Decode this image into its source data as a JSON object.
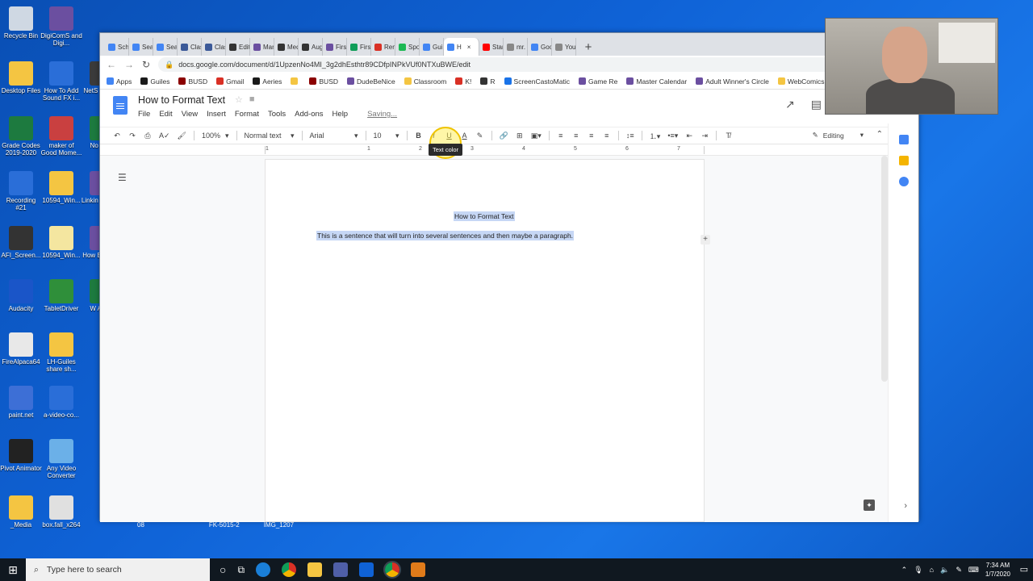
{
  "desktop": {
    "icons": [
      {
        "label": "Recycle Bin",
        "color": "#cfd8e3"
      },
      {
        "label": "DigiComS and Digi...",
        "color": "#6b4fa0"
      },
      {
        "label": "Desktop Files",
        "color": "#f4c542"
      },
      {
        "label": "How To Add Sound FX i...",
        "color": "#2a6ed8"
      },
      {
        "label": "NetS Scho...",
        "color": "#3a3a3a"
      },
      {
        "label": "Grade Codes 2019-2020",
        "color": "#1d7a3f"
      },
      {
        "label": "maker of Good Mome...",
        "color": "#c94040"
      },
      {
        "label": "No Ph...",
        "color": "#1d7a3f"
      },
      {
        "label": "Recording #21",
        "color": "#2a6ed8"
      },
      {
        "label": "10594_Win...",
        "color": "#f4c542"
      },
      {
        "label": "Linkin to Pla...",
        "color": "#6b4fa0"
      },
      {
        "label": "AFI_Screen...",
        "color": "#333333"
      },
      {
        "label": "10594_Win...",
        "color": "#f4e6a0"
      },
      {
        "label": "How Bad G...",
        "color": "#6b4fa0"
      },
      {
        "label": "Audacity",
        "color": "#1a55c8"
      },
      {
        "label": "TabletDriver",
        "color": "#2f8f3a"
      },
      {
        "label": "W Ass...",
        "color": "#1d7a3f"
      },
      {
        "label": "FireAlpaca64",
        "color": "#e8e8e8"
      },
      {
        "label": "LH-Guiles share sh...",
        "color": "#f4c542"
      },
      {
        "label": "paint.net",
        "color": "#3d6fd6"
      },
      {
        "label": "a-video-co...",
        "color": "#2a6ed8"
      },
      {
        "label": "Pivot Animator",
        "color": "#222222"
      },
      {
        "label": "Any Video Converter",
        "color": "#6bb0e8"
      },
      {
        "label": "_Media",
        "color": "#f4c542"
      },
      {
        "label": "box.fall_x264",
        "color": "#e0e0e0"
      }
    ],
    "lower_labels": [
      "08",
      "FK-5015-2",
      "IMG_1207"
    ]
  },
  "browser": {
    "tabs": [
      {
        "label": "Scho",
        "color": "#4285f4"
      },
      {
        "label": "Seat",
        "color": "#4285f4"
      },
      {
        "label": "Seat",
        "color": "#4285f4"
      },
      {
        "label": "Clas",
        "color": "#3b5998"
      },
      {
        "label": "Clas",
        "color": "#3b5998"
      },
      {
        "label": "Edit",
        "color": "#333333"
      },
      {
        "label": "Man",
        "color": "#6b4fa0"
      },
      {
        "label": "Med",
        "color": "#333333"
      },
      {
        "label": "Augu",
        "color": "#333333"
      },
      {
        "label": "First",
        "color": "#6b4fa0"
      },
      {
        "label": "First",
        "color": "#0f9d58"
      },
      {
        "label": "Rem",
        "color": "#d93025"
      },
      {
        "label": "Spot",
        "color": "#1db954"
      },
      {
        "label": "Guile",
        "color": "#4285f4"
      },
      {
        "label": "H",
        "color": "#4285f4",
        "active": true
      },
      {
        "label": "Star",
        "color": "#ff0000"
      },
      {
        "label": "mr. g",
        "color": "#888888"
      },
      {
        "label": "Goo",
        "color": "#4285f4"
      },
      {
        "label": "Your",
        "color": "#888888"
      }
    ],
    "close_glyph": "×",
    "new_tab": "+",
    "url": "docs.google.com/document/d/1UpzenNo4MI_3g2dhEsthtr89CDfpINPkVUf0NTXuBWE/edit",
    "bookmarks": [
      {
        "label": "Apps",
        "color": "#4285f4"
      },
      {
        "label": "Guiles",
        "color": "#1a1a1a"
      },
      {
        "label": "BUSD",
        "color": "#8b0000"
      },
      {
        "label": "Gmail",
        "color": "#d93025"
      },
      {
        "label": "Aeries",
        "color": "#1a1a1a"
      },
      {
        "label": "",
        "color": "#f4c542"
      },
      {
        "label": "BUSD",
        "color": "#8b0000"
      },
      {
        "label": "DudeBeNice",
        "color": "#6b4fa0"
      },
      {
        "label": "Classroom",
        "color": "#f4c542"
      },
      {
        "label": "K!",
        "color": "#d93025"
      },
      {
        "label": "R",
        "color": "#333333"
      },
      {
        "label": "ScreenCastoMatic",
        "color": "#1a73e8"
      },
      {
        "label": "Game Re",
        "color": "#6b4fa0"
      },
      {
        "label": "Master Calendar",
        "color": "#6b4fa0"
      },
      {
        "label": "Adult Winner's Circle",
        "color": "#6b4fa0"
      },
      {
        "label": "WebComics",
        "color": "#f4c542"
      }
    ]
  },
  "docs": {
    "title": "How to Format Text",
    "menu": [
      "File",
      "Edit",
      "View",
      "Insert",
      "Format",
      "Tools",
      "Add-ons",
      "Help"
    ],
    "saving": "Saving...",
    "toolbar": {
      "zoom": "100%",
      "style": "Normal text",
      "font": "Arial",
      "size": "10",
      "bold": "B",
      "italic": "I",
      "underline": "U",
      "text_color": "A",
      "editing": "Editing"
    },
    "tooltip": "Text color",
    "ruler_numbers": [
      "1",
      "1",
      "2",
      "3",
      "4",
      "5",
      "6",
      "7"
    ],
    "page": {
      "heading": "How to Format Text",
      "body": "This is a sentence that will turn into several sentences and then maybe a paragraph."
    }
  },
  "taskbar": {
    "search_placeholder": "Type here to search",
    "time": "7:34 AM",
    "date": "1/7/2020"
  },
  "colors": {
    "selection": "#c6d7f5",
    "docs_blue": "#4285f4",
    "desktop_blue": "#0f62d6"
  }
}
